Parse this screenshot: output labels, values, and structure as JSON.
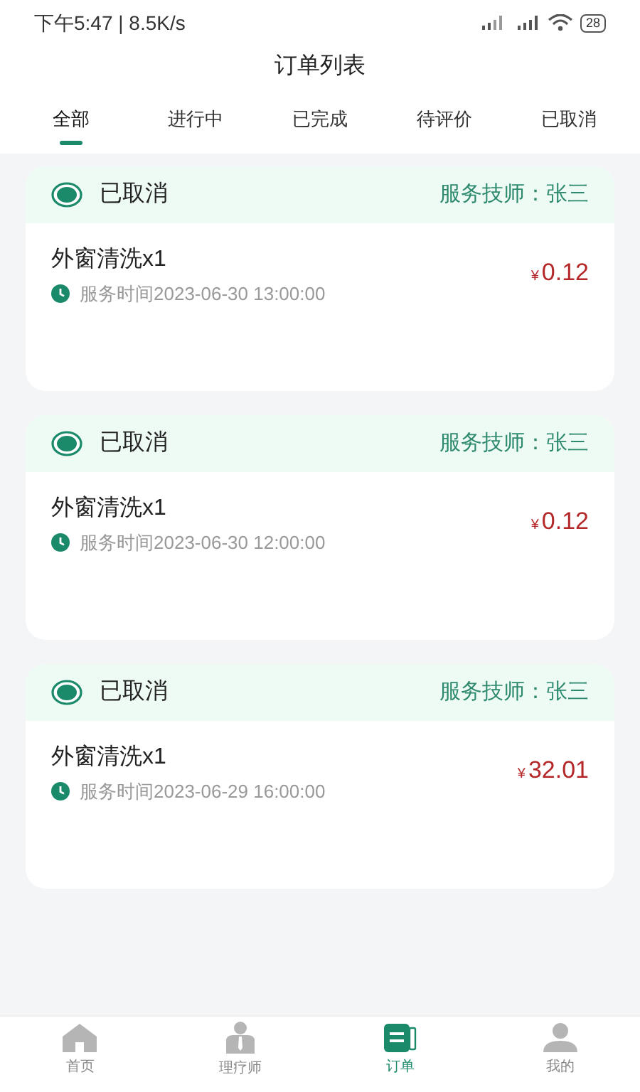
{
  "status_bar": {
    "time": "下午5:47 | 8.5K/s",
    "battery": "28"
  },
  "title": "订单列表",
  "tabs": [
    {
      "label": "全部",
      "selected": true
    },
    {
      "label": "进行中",
      "selected": false
    },
    {
      "label": "已完成",
      "selected": false
    },
    {
      "label": "待评价",
      "selected": false
    },
    {
      "label": "已取消",
      "selected": false
    }
  ],
  "orders": [
    {
      "status": "已取消",
      "technician": "服务技师：张三",
      "item": "外窗清洗x1",
      "time": "服务时间2023-06-30 13:00:00",
      "currency": "¥",
      "price": "0.12"
    },
    {
      "status": "已取消",
      "technician": "服务技师：张三",
      "item": "外窗清洗x1",
      "time": "服务时间2023-06-30 12:00:00",
      "currency": "¥",
      "price": "0.12"
    },
    {
      "status": "已取消",
      "technician": "服务技师：张三",
      "item": "外窗清洗x1",
      "time": "服务时间2023-06-29 16:00:00",
      "currency": "¥",
      "price": "32.01"
    }
  ],
  "bottom_nav": [
    {
      "label": "首页",
      "kind": "home",
      "selected": false
    },
    {
      "label": "理疗师",
      "kind": "therapist",
      "selected": false
    },
    {
      "label": "订单",
      "kind": "orders",
      "selected": true
    },
    {
      "label": "我的",
      "kind": "profile",
      "selected": false
    }
  ]
}
